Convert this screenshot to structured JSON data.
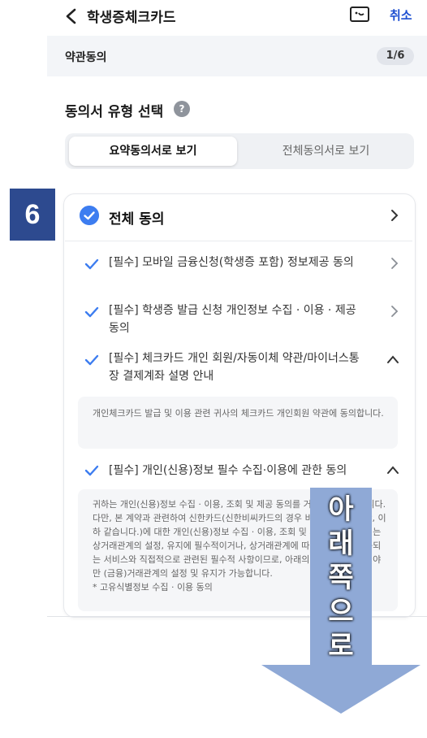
{
  "header": {
    "title": "학생증체크카드",
    "cancel_label": "취소"
  },
  "stepbar": {
    "label": "약관동의",
    "step": "1/6"
  },
  "section_title": "동의서 유형 선택",
  "section_help": "?",
  "tabs": [
    {
      "label": "요약동의서로 보기",
      "active": true
    },
    {
      "label": "전체동의서로 보기",
      "active": false
    }
  ],
  "step_number": "6",
  "agree_all": "전체 동의",
  "items": [
    {
      "label": "[필수] 모바일 금융신청(학생증 포함) 정보제공 동의"
    },
    {
      "label": "[필수] 학생증 발급 신청 개인정보 수집 · 이용 · 제공 동의"
    },
    {
      "label": "[필수] 체크카드 개인 회원/자동이체 약관/마이너스통장 결제계좌 설명 안내"
    },
    {
      "label": "[필수] 개인(신용)정보 필수 수집·이용에 관한 동의"
    }
  ],
  "details": {
    "item3": "개인체크카드 발급 및 이용 관련 귀사의 체크카드 개인회원 약관에 동의합니다.",
    "item4": "귀하는 개인(신용)정보 수집 · 이용, 조회 및 제공 동의를 거부하실 수 있습니다.\n다만, 본 계약과 관련하여 신한카드(신한비씨카드의 경우 비씨카드(주) 포함, 이하 같습니다.)에 대한 개인(신용)정보 수집 · 이용, 조회 및 제공에 관한 동의는 상거래관계의 설정, 유지에 필수적이거나, 상거래관계에 따라 귀하에게 제공되는 서비스와 직접적으로 관련된 필수적 사항이므로, 아래의 사항에 동의하셔야만 (금융)거래관계의 설정 및 유지가 가능합니다.\n* 고유식별정보 수집 · 이용 동의"
  },
  "overlay_text": [
    "아",
    "래",
    "쪽",
    "으",
    "로"
  ],
  "colors": {
    "accent": "#1e4fd1",
    "check": "#3d7df0",
    "badge": "#2d4a8f",
    "arrow": "#8fa9d6"
  },
  "icons": {
    "back": "chevron-left-icon",
    "help": "chat-help-icon",
    "check": "check-icon",
    "chevron": "chevron-right-icon"
  }
}
